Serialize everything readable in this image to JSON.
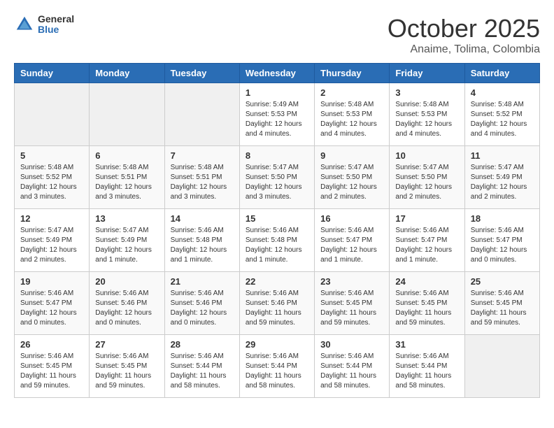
{
  "header": {
    "logo_general": "General",
    "logo_blue": "Blue",
    "month_title": "October 2025",
    "location": "Anaime, Tolima, Colombia"
  },
  "days_of_week": [
    "Sunday",
    "Monday",
    "Tuesday",
    "Wednesday",
    "Thursday",
    "Friday",
    "Saturday"
  ],
  "weeks": [
    [
      {
        "day": "",
        "info": ""
      },
      {
        "day": "",
        "info": ""
      },
      {
        "day": "",
        "info": ""
      },
      {
        "day": "1",
        "info": "Sunrise: 5:49 AM\nSunset: 5:53 PM\nDaylight: 12 hours\nand 4 minutes."
      },
      {
        "day": "2",
        "info": "Sunrise: 5:48 AM\nSunset: 5:53 PM\nDaylight: 12 hours\nand 4 minutes."
      },
      {
        "day": "3",
        "info": "Sunrise: 5:48 AM\nSunset: 5:53 PM\nDaylight: 12 hours\nand 4 minutes."
      },
      {
        "day": "4",
        "info": "Sunrise: 5:48 AM\nSunset: 5:52 PM\nDaylight: 12 hours\nand 4 minutes."
      }
    ],
    [
      {
        "day": "5",
        "info": "Sunrise: 5:48 AM\nSunset: 5:52 PM\nDaylight: 12 hours\nand 3 minutes."
      },
      {
        "day": "6",
        "info": "Sunrise: 5:48 AM\nSunset: 5:51 PM\nDaylight: 12 hours\nand 3 minutes."
      },
      {
        "day": "7",
        "info": "Sunrise: 5:48 AM\nSunset: 5:51 PM\nDaylight: 12 hours\nand 3 minutes."
      },
      {
        "day": "8",
        "info": "Sunrise: 5:47 AM\nSunset: 5:50 PM\nDaylight: 12 hours\nand 3 minutes."
      },
      {
        "day": "9",
        "info": "Sunrise: 5:47 AM\nSunset: 5:50 PM\nDaylight: 12 hours\nand 2 minutes."
      },
      {
        "day": "10",
        "info": "Sunrise: 5:47 AM\nSunset: 5:50 PM\nDaylight: 12 hours\nand 2 minutes."
      },
      {
        "day": "11",
        "info": "Sunrise: 5:47 AM\nSunset: 5:49 PM\nDaylight: 12 hours\nand 2 minutes."
      }
    ],
    [
      {
        "day": "12",
        "info": "Sunrise: 5:47 AM\nSunset: 5:49 PM\nDaylight: 12 hours\nand 2 minutes."
      },
      {
        "day": "13",
        "info": "Sunrise: 5:47 AM\nSunset: 5:49 PM\nDaylight: 12 hours\nand 1 minute."
      },
      {
        "day": "14",
        "info": "Sunrise: 5:46 AM\nSunset: 5:48 PM\nDaylight: 12 hours\nand 1 minute."
      },
      {
        "day": "15",
        "info": "Sunrise: 5:46 AM\nSunset: 5:48 PM\nDaylight: 12 hours\nand 1 minute."
      },
      {
        "day": "16",
        "info": "Sunrise: 5:46 AM\nSunset: 5:47 PM\nDaylight: 12 hours\nand 1 minute."
      },
      {
        "day": "17",
        "info": "Sunrise: 5:46 AM\nSunset: 5:47 PM\nDaylight: 12 hours\nand 1 minute."
      },
      {
        "day": "18",
        "info": "Sunrise: 5:46 AM\nSunset: 5:47 PM\nDaylight: 12 hours\nand 0 minutes."
      }
    ],
    [
      {
        "day": "19",
        "info": "Sunrise: 5:46 AM\nSunset: 5:47 PM\nDaylight: 12 hours\nand 0 minutes."
      },
      {
        "day": "20",
        "info": "Sunrise: 5:46 AM\nSunset: 5:46 PM\nDaylight: 12 hours\nand 0 minutes."
      },
      {
        "day": "21",
        "info": "Sunrise: 5:46 AM\nSunset: 5:46 PM\nDaylight: 12 hours\nand 0 minutes."
      },
      {
        "day": "22",
        "info": "Sunrise: 5:46 AM\nSunset: 5:46 PM\nDaylight: 11 hours\nand 59 minutes."
      },
      {
        "day": "23",
        "info": "Sunrise: 5:46 AM\nSunset: 5:45 PM\nDaylight: 11 hours\nand 59 minutes."
      },
      {
        "day": "24",
        "info": "Sunrise: 5:46 AM\nSunset: 5:45 PM\nDaylight: 11 hours\nand 59 minutes."
      },
      {
        "day": "25",
        "info": "Sunrise: 5:46 AM\nSunset: 5:45 PM\nDaylight: 11 hours\nand 59 minutes."
      }
    ],
    [
      {
        "day": "26",
        "info": "Sunrise: 5:46 AM\nSunset: 5:45 PM\nDaylight: 11 hours\nand 59 minutes."
      },
      {
        "day": "27",
        "info": "Sunrise: 5:46 AM\nSunset: 5:45 PM\nDaylight: 11 hours\nand 59 minutes."
      },
      {
        "day": "28",
        "info": "Sunrise: 5:46 AM\nSunset: 5:44 PM\nDaylight: 11 hours\nand 58 minutes."
      },
      {
        "day": "29",
        "info": "Sunrise: 5:46 AM\nSunset: 5:44 PM\nDaylight: 11 hours\nand 58 minutes."
      },
      {
        "day": "30",
        "info": "Sunrise: 5:46 AM\nSunset: 5:44 PM\nDaylight: 11 hours\nand 58 minutes."
      },
      {
        "day": "31",
        "info": "Sunrise: 5:46 AM\nSunset: 5:44 PM\nDaylight: 11 hours\nand 58 minutes."
      },
      {
        "day": "",
        "info": ""
      }
    ]
  ]
}
